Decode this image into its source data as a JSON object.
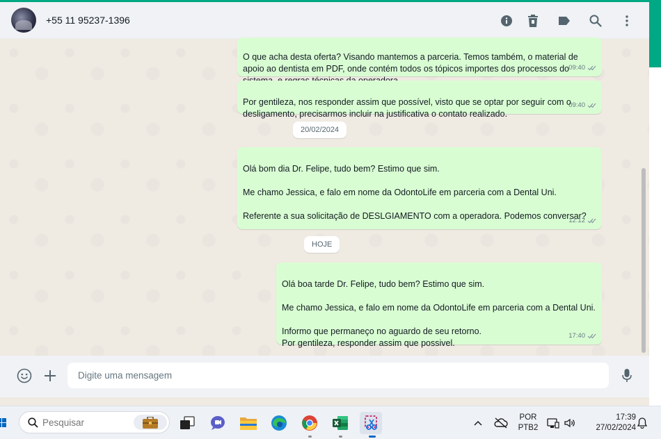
{
  "header": {
    "contact_name": "+55 11 95237-1396",
    "icons": [
      "info-icon",
      "delete-icon",
      "label-icon",
      "search-icon",
      "menu-icon"
    ]
  },
  "messages": [
    {
      "text": "O que acha desta oferta? Visando mantemos a parceria. Temos também, o material de apoio ao dentista em PDF, onde contém todos os tópicos importes dos processos do sistema, e regras técnicas da operadora.",
      "time": "09:40"
    },
    {
      "text": "Por gentileza, nos responder assim que possível, visto que se optar por seguir com o desligamento, precisarmos incluir na justificativa o contato realizado.",
      "time": "09:40"
    },
    {
      "text": "Olá bom dia Dr. Felipe, tudo bem? Estimo que sim.\n\nMe chamo Jessica, e falo em nome da OdontoLife em parceria com a Dental Uni.\n\nReferente a sua solicitação de DESLGIAMENTO com a operadora. Podemos conversar?",
      "time": "12:12"
    },
    {
      "text": "Olá boa tarde Dr. Felipe, tudo bem? Estimo que sim.\n\nMe chamo Jessica, e falo em nome da OdontoLife em parceria com a Dental Uni.\n\nInformo que permaneço no aguardo de seu retorno.\nPor gentileza, responder assim que possivel.",
      "time": "17:40"
    }
  ],
  "date_separators": [
    "20/02/2024",
    "HOJE"
  ],
  "composer": {
    "placeholder": "Digite uma mensagem"
  },
  "taskbar": {
    "search_placeholder": "Pesquisar",
    "language": "POR",
    "keyboard_layout": "PTB2",
    "time": "17:39",
    "date": "27/02/2024"
  },
  "colors": {
    "accent": "#00a884",
    "outgoing_bubble": "#d9fdd3",
    "chat_background": "#efeae2",
    "tick_read": "#53bdeb",
    "tick_sent": "#8696a0"
  }
}
